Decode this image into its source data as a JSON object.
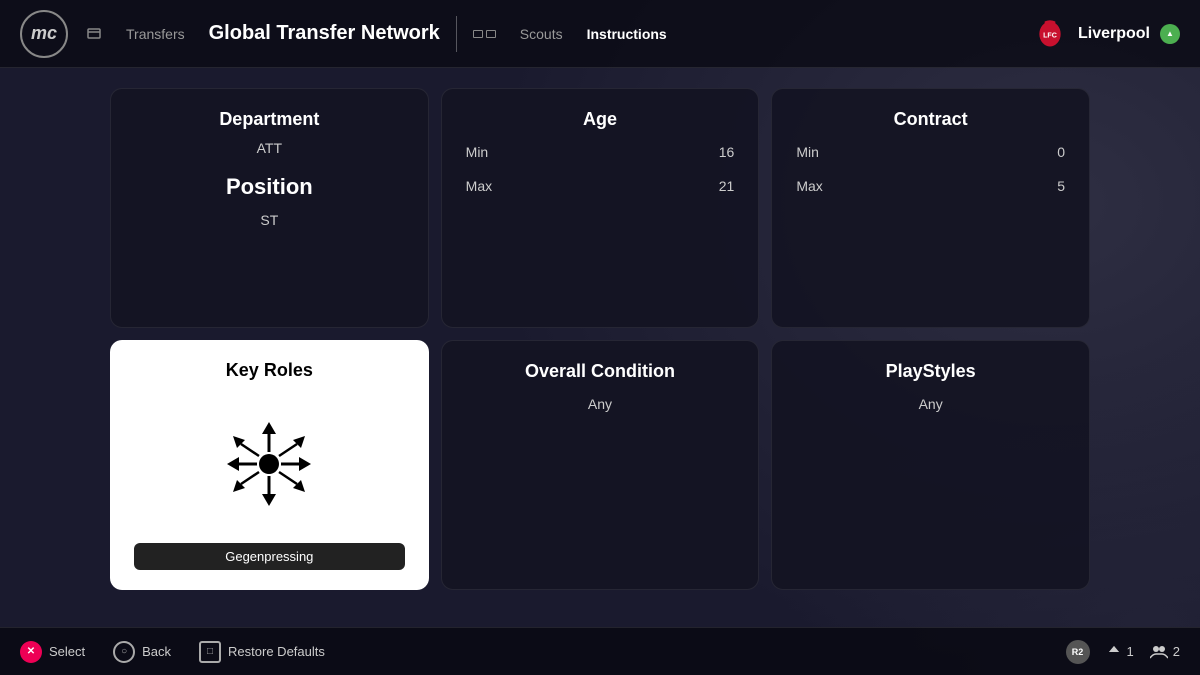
{
  "header": {
    "logo": "mc",
    "nav": {
      "transfers_label": "Transfers",
      "global_label": "Global Transfer Network",
      "scouts_label": "Scouts",
      "instructions_label": "Instructions"
    },
    "club": {
      "name": "Liverpool",
      "abbr": "LFC"
    }
  },
  "cards": {
    "department": {
      "title": "Department",
      "value": "ATT"
    },
    "position": {
      "title": "Position",
      "value": "ST"
    },
    "age": {
      "title": "Age",
      "min_label": "Min",
      "max_label": "Max",
      "min_value": "16",
      "max_value": "21"
    },
    "contract": {
      "title": "Contract",
      "min_label": "Min",
      "max_label": "Max",
      "min_value": "0",
      "max_value": "5"
    },
    "key_roles": {
      "title": "Key Roles",
      "role_label": "Gegenpressing"
    },
    "overall_condition": {
      "title": "Overall Condition",
      "value": "Any"
    },
    "playstyles": {
      "title": "PlayStyles",
      "value": "Any"
    }
  },
  "footer": {
    "select_label": "Select",
    "back_label": "Back",
    "restore_label": "Restore Defaults",
    "r2_label": "R2",
    "stat1_value": "1",
    "stat2_value": "2"
  }
}
